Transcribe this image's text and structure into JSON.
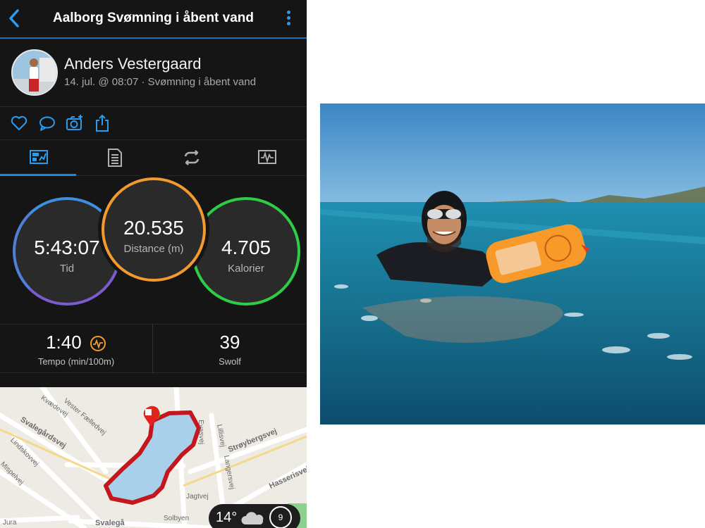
{
  "header": {
    "title": "Aalborg Svømning i åbent vand"
  },
  "profile": {
    "name": "Anders Vestergaard",
    "subtitle": "14. jul. @ 08:07 · Svømning i åbent vand"
  },
  "actions": [
    {
      "icon": "heart-icon"
    },
    {
      "icon": "comment-icon"
    },
    {
      "icon": "camera-add-icon"
    },
    {
      "icon": "share-icon"
    }
  ],
  "tabs": [
    {
      "icon": "summary-icon",
      "active": true
    },
    {
      "icon": "details-icon",
      "active": false
    },
    {
      "icon": "laps-icon",
      "active": false
    },
    {
      "icon": "graphs-icon",
      "active": false
    }
  ],
  "rings": {
    "time": {
      "value": "5:43:07",
      "label": "Tid",
      "color": "#7a5ccd"
    },
    "distance": {
      "value": "20.535",
      "label": "Distance (m)",
      "color": "#f29a2e"
    },
    "calories": {
      "value": "4.705",
      "label": "Kalorier",
      "color": "#2fcc46"
    }
  },
  "stats": {
    "pace": {
      "value": "1:40",
      "label": "Tempo (min/100m)"
    },
    "swolf": {
      "value": "39",
      "label": "Swolf"
    }
  },
  "map": {
    "streets": [
      "Kvædevej",
      "Vester Fælledvej",
      "Svalegårdsvej",
      "Lindskovvej",
      "Mispelvej",
      "Evasvej",
      "Lillisvej",
      "Strøybergsvej",
      "Langersvej",
      "Hasserisvej",
      "Jagtvej",
      "Solbyen",
      "Svalegå",
      "Jura"
    ],
    "route_color": "#c4161c"
  },
  "weather": {
    "temperature": "14°",
    "wind": "9"
  },
  "colors": {
    "accent": "#2a9cf0",
    "background": "#151515"
  }
}
